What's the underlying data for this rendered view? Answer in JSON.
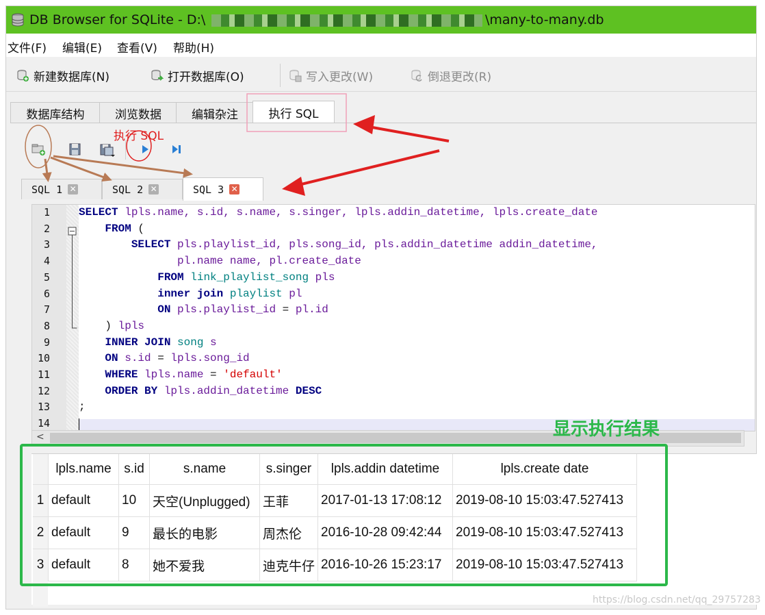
{
  "window": {
    "title_prefix": "DB Browser for SQLite - D:\\",
    "title_suffix": "\\many-to-many.db"
  },
  "menu": [
    {
      "label": "文件(F)"
    },
    {
      "label": "编辑(E)"
    },
    {
      "label": "查看(V)"
    },
    {
      "label": "帮助(H)"
    }
  ],
  "toolbar": {
    "new_db": "新建数据库(N)",
    "open_db": "打开数据库(O)",
    "write_changes": "写入更改(W)",
    "revert_changes": "倒退更改(R)"
  },
  "main_tabs": [
    {
      "label": "数据库结构"
    },
    {
      "label": "浏览数据"
    },
    {
      "label": "编辑杂注"
    },
    {
      "label": "执行 SQL",
      "active": true
    }
  ],
  "annotations": {
    "execute_sql": "执行 SQL",
    "results_label": "显示执行结果"
  },
  "sql_tabs": [
    {
      "label": "SQL 1"
    },
    {
      "label": "SQL 2"
    },
    {
      "label": "SQL 3",
      "active": true
    }
  ],
  "editor": {
    "line_numbers": [
      "1",
      "2",
      "3",
      "4",
      "5",
      "6",
      "7",
      "8",
      "9",
      "10",
      "11",
      "12",
      "13",
      "14"
    ],
    "lines": [
      [
        {
          "t": "SELECT",
          "c": "kw"
        },
        {
          "t": " lpls.name, s.id, s.name, s.singer, lpls.addin_datetime, lpls.create_date"
        }
      ],
      [
        {
          "t": "    "
        },
        {
          "t": "FROM",
          "c": "kw"
        },
        {
          "t": " (",
          "c": "op"
        }
      ],
      [
        {
          "t": "        "
        },
        {
          "t": "SELECT",
          "c": "kw"
        },
        {
          "t": " pls.playlist_id, pls.song_id, pls.addin_datetime addin_datetime,"
        }
      ],
      [
        {
          "t": "               pl.name name, pl.create_date"
        }
      ],
      [
        {
          "t": "            "
        },
        {
          "t": "FROM",
          "c": "kw"
        },
        {
          "t": " "
        },
        {
          "t": "link_playlist_song",
          "c": "tbl"
        },
        {
          "t": " pls"
        }
      ],
      [
        {
          "t": "            "
        },
        {
          "t": "inner join",
          "c": "kw"
        },
        {
          "t": " "
        },
        {
          "t": "playlist",
          "c": "tbl"
        },
        {
          "t": " pl"
        }
      ],
      [
        {
          "t": "            "
        },
        {
          "t": "ON",
          "c": "kw"
        },
        {
          "t": " pls.playlist_id "
        },
        {
          "t": "=",
          "c": "op"
        },
        {
          "t": " pl.id"
        }
      ],
      [
        {
          "t": "    "
        },
        {
          "t": ")",
          "c": "op"
        },
        {
          "t": " lpls"
        }
      ],
      [
        {
          "t": "    "
        },
        {
          "t": "INNER JOIN",
          "c": "kw"
        },
        {
          "t": " "
        },
        {
          "t": "song",
          "c": "tbl"
        },
        {
          "t": " s"
        }
      ],
      [
        {
          "t": "    "
        },
        {
          "t": "ON",
          "c": "kw"
        },
        {
          "t": " s.id "
        },
        {
          "t": "=",
          "c": "op"
        },
        {
          "t": " lpls.song_id"
        }
      ],
      [
        {
          "t": "    "
        },
        {
          "t": "WHERE",
          "c": "kw"
        },
        {
          "t": " lpls.name "
        },
        {
          "t": "=",
          "c": "op"
        },
        {
          "t": " "
        },
        {
          "t": "'default'",
          "c": "str"
        }
      ],
      [
        {
          "t": "    "
        },
        {
          "t": "ORDER BY",
          "c": "kw"
        },
        {
          "t": " lpls.addin_datetime "
        },
        {
          "t": "DESC",
          "c": "kw"
        }
      ],
      [
        {
          "t": ";",
          "c": "op"
        }
      ],
      [
        {
          "t": ""
        }
      ]
    ]
  },
  "results": {
    "columns": [
      "lpls.name",
      "s.id",
      "s.name",
      "s.singer",
      "lpls.addin datetime",
      "lpls.create date"
    ],
    "rows": [
      {
        "num": "1",
        "cells": [
          "default",
          "10",
          "天空(Unplugged)",
          "王菲",
          "2017-01-13 17:08:12",
          "2019-08-10 15:03:47.527413"
        ]
      },
      {
        "num": "2",
        "cells": [
          "default",
          "9",
          "最长的电影",
          "周杰伦",
          "2016-10-28 09:42:44",
          "2019-08-10 15:03:47.527413"
        ]
      },
      {
        "num": "3",
        "cells": [
          "default",
          "8",
          "她不爱我",
          "迪克牛仔",
          "2016-10-26 15:23:17",
          "2019-08-10 15:03:47.527413"
        ]
      }
    ]
  },
  "watermark": "https://blog.csdn.net/qq_29757283",
  "colors": {
    "titlebar": "#5ec122",
    "keyword": "#000080",
    "table_name": "#008080",
    "string": "#d40000",
    "identifier": "#6a1b9a",
    "annotation_red": "#e02020",
    "annotation_green": "#2cb84a",
    "annotation_brown": "#b87a55",
    "annotation_pink": "#f0a0b8"
  }
}
